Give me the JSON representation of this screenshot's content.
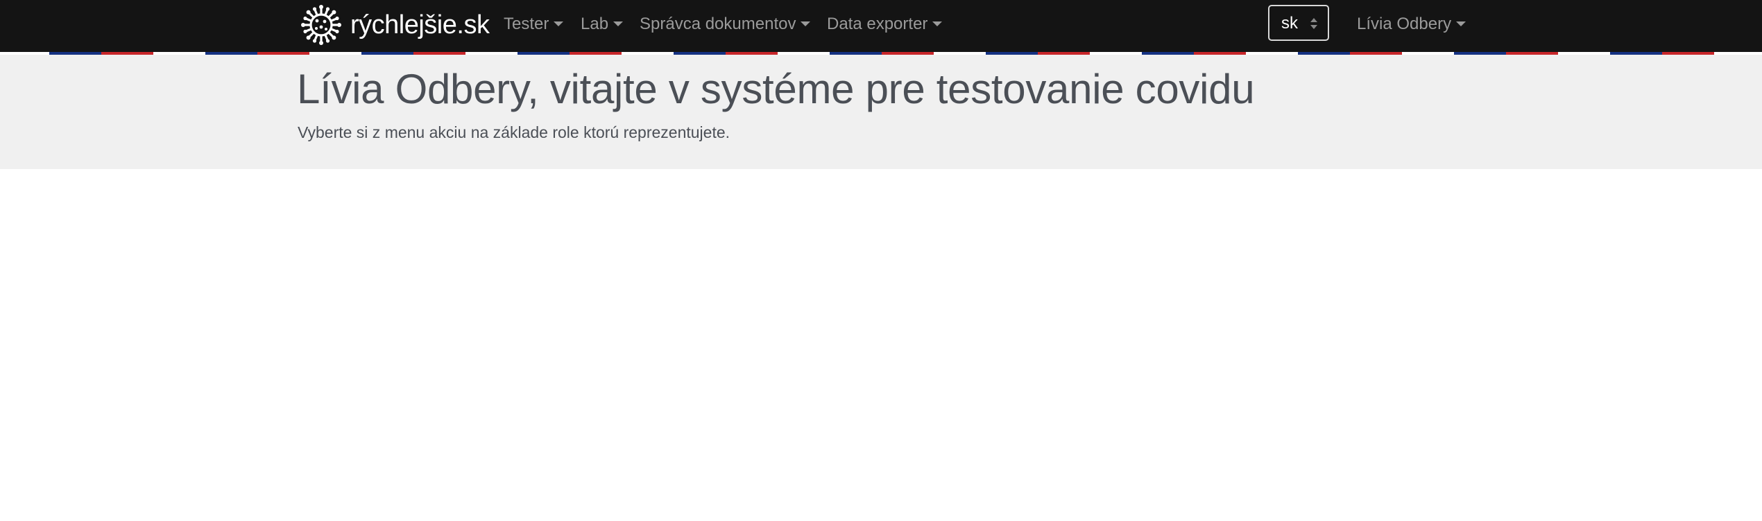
{
  "brand": {
    "name": "rýchlejšie.sk",
    "logo_icon": "virus-icon",
    "color": "#ffffff"
  },
  "nav": {
    "items": [
      {
        "label": "Tester"
      },
      {
        "label": "Lab"
      },
      {
        "label": "Správca dokumentov"
      },
      {
        "label": "Data exporter"
      }
    ],
    "language": {
      "selected": "sk"
    },
    "user": {
      "label": "Lívia Odbery"
    }
  },
  "flag_colors": {
    "blue": "#153282",
    "red": "#c8262a",
    "white": "#ffffff"
  },
  "main": {
    "title": "Lívia Odbery, vitajte v systéme pre testovanie covidu",
    "subtitle": "Vyberte si z menu akciu na základe role ktorú reprezentujete."
  }
}
